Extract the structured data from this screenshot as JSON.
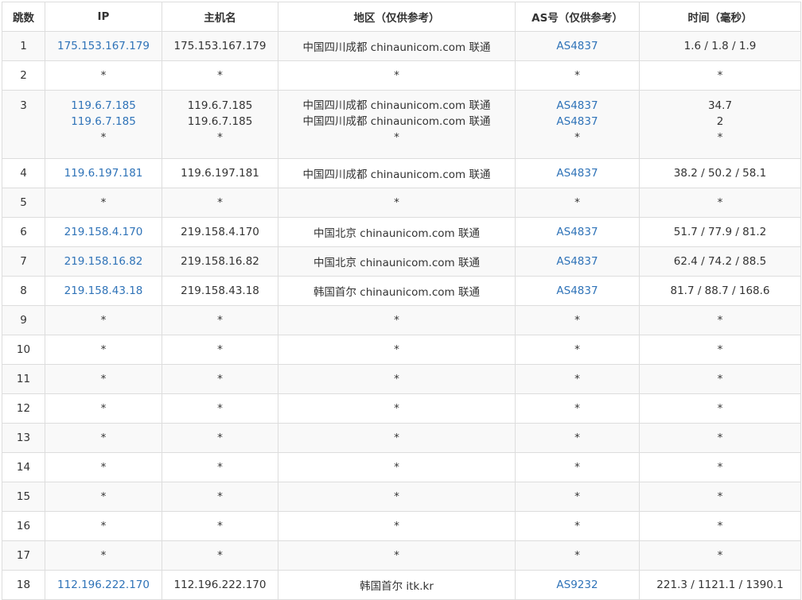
{
  "headers": [
    "跳数",
    "IP",
    "主机名",
    "地区（仅供参考）",
    "AS号（仅供参考）",
    "时间（毫秒）"
  ],
  "rows": [
    {
      "hop": "1",
      "ip": [
        "175.153.167.179"
      ],
      "host": [
        "175.153.167.179"
      ],
      "region": [
        "中国四川成都 chinaunicom.com 联通"
      ],
      "asn": [
        "AS4837"
      ],
      "time": [
        "1.6 / 1.8 / 1.9"
      ]
    },
    {
      "hop": "2",
      "ip": [
        "*"
      ],
      "host": [
        "*"
      ],
      "region": [
        "*"
      ],
      "asn": [
        "*"
      ],
      "time": [
        "*"
      ]
    },
    {
      "hop": "3",
      "ip": [
        "119.6.7.185",
        "119.6.7.185",
        "*"
      ],
      "host": [
        "119.6.7.185",
        "119.6.7.185",
        "*"
      ],
      "region": [
        "中国四川成都 chinaunicom.com 联通",
        "中国四川成都 chinaunicom.com 联通",
        "*"
      ],
      "asn": [
        "AS4837",
        "AS4837",
        "*"
      ],
      "time": [
        "34.7",
        "2",
        "*"
      ]
    },
    {
      "hop": "4",
      "ip": [
        "119.6.197.181"
      ],
      "host": [
        "119.6.197.181"
      ],
      "region": [
        "中国四川成都 chinaunicom.com 联通"
      ],
      "asn": [
        "AS4837"
      ],
      "time": [
        "38.2 / 50.2 / 58.1"
      ]
    },
    {
      "hop": "5",
      "ip": [
        "*"
      ],
      "host": [
        "*"
      ],
      "region": [
        "*"
      ],
      "asn": [
        "*"
      ],
      "time": [
        "*"
      ]
    },
    {
      "hop": "6",
      "ip": [
        "219.158.4.170"
      ],
      "host": [
        "219.158.4.170"
      ],
      "region": [
        "中国北京 chinaunicom.com 联通"
      ],
      "asn": [
        "AS4837"
      ],
      "time": [
        "51.7 / 77.9 / 81.2"
      ]
    },
    {
      "hop": "7",
      "ip": [
        "219.158.16.82"
      ],
      "host": [
        "219.158.16.82"
      ],
      "region": [
        "中国北京 chinaunicom.com 联通"
      ],
      "asn": [
        "AS4837"
      ],
      "time": [
        "62.4 / 74.2 / 88.5"
      ]
    },
    {
      "hop": "8",
      "ip": [
        "219.158.43.18"
      ],
      "host": [
        "219.158.43.18"
      ],
      "region": [
        "韩国首尔 chinaunicom.com 联通"
      ],
      "asn": [
        "AS4837"
      ],
      "time": [
        "81.7 / 88.7 / 168.6"
      ]
    },
    {
      "hop": "9",
      "ip": [
        "*"
      ],
      "host": [
        "*"
      ],
      "region": [
        "*"
      ],
      "asn": [
        "*"
      ],
      "time": [
        "*"
      ]
    },
    {
      "hop": "10",
      "ip": [
        "*"
      ],
      "host": [
        "*"
      ],
      "region": [
        "*"
      ],
      "asn": [
        "*"
      ],
      "time": [
        "*"
      ]
    },
    {
      "hop": "11",
      "ip": [
        "*"
      ],
      "host": [
        "*"
      ],
      "region": [
        "*"
      ],
      "asn": [
        "*"
      ],
      "time": [
        "*"
      ]
    },
    {
      "hop": "12",
      "ip": [
        "*"
      ],
      "host": [
        "*"
      ],
      "region": [
        "*"
      ],
      "asn": [
        "*"
      ],
      "time": [
        "*"
      ]
    },
    {
      "hop": "13",
      "ip": [
        "*"
      ],
      "host": [
        "*"
      ],
      "region": [
        "*"
      ],
      "asn": [
        "*"
      ],
      "time": [
        "*"
      ]
    },
    {
      "hop": "14",
      "ip": [
        "*"
      ],
      "host": [
        "*"
      ],
      "region": [
        "*"
      ],
      "asn": [
        "*"
      ],
      "time": [
        "*"
      ]
    },
    {
      "hop": "15",
      "ip": [
        "*"
      ],
      "host": [
        "*"
      ],
      "region": [
        "*"
      ],
      "asn": [
        "*"
      ],
      "time": [
        "*"
      ]
    },
    {
      "hop": "16",
      "ip": [
        "*"
      ],
      "host": [
        "*"
      ],
      "region": [
        "*"
      ],
      "asn": [
        "*"
      ],
      "time": [
        "*"
      ]
    },
    {
      "hop": "17",
      "ip": [
        "*"
      ],
      "host": [
        "*"
      ],
      "region": [
        "*"
      ],
      "asn": [
        "*"
      ],
      "time": [
        "*"
      ]
    },
    {
      "hop": "18",
      "ip": [
        "112.196.222.170"
      ],
      "host": [
        "112.196.222.170"
      ],
      "region": [
        "韩国首尔 itk.kr"
      ],
      "asn": [
        "AS9232"
      ],
      "time": [
        "221.3 / 1121.1 / 1390.1"
      ]
    }
  ],
  "colors": {
    "link": "#2f73b8",
    "border": "#dddddd",
    "row_alt": "#f9f9f9",
    "text": "#333333"
  }
}
